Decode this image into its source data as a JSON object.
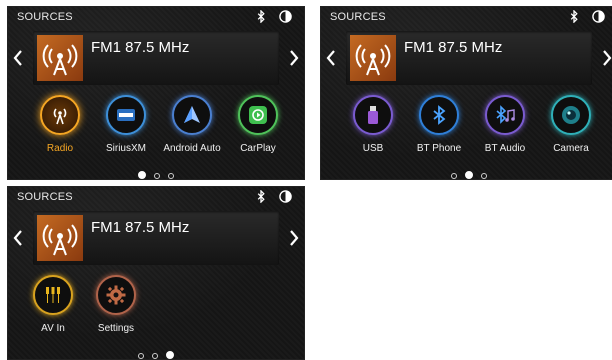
{
  "screens": [
    {
      "title": "SOURCES",
      "station": "FM1 87.5 MHz",
      "sources": [
        {
          "label": "Radio",
          "icon": "radio-tower-icon",
          "color": "#f5a623",
          "active": true
        },
        {
          "label": "SiriusXM",
          "icon": "siriusxm-icon",
          "color": "#3d8fd8",
          "active": false
        },
        {
          "label": "Android Auto",
          "icon": "android-auto-icon",
          "color": "#4a7fd0",
          "active": false
        },
        {
          "label": "CarPlay",
          "icon": "carplay-icon",
          "color": "#4fc25a",
          "active": false
        }
      ],
      "page": 1,
      "pages": 3
    },
    {
      "title": "SOURCES",
      "station": "FM1 87.5 MHz",
      "sources": [
        {
          "label": "USB",
          "icon": "usb-icon",
          "color": "#7a5bd0",
          "active": false
        },
        {
          "label": "BT Phone",
          "icon": "bluetooth-icon",
          "color": "#2f7fd8",
          "active": false
        },
        {
          "label": "BT Audio",
          "icon": "bluetooth-audio-icon",
          "color": "#7a5bd0",
          "active": false
        },
        {
          "label": "Camera",
          "icon": "camera-icon",
          "color": "#2fb0b8",
          "active": false
        }
      ],
      "page": 2,
      "pages": 3
    },
    {
      "title": "SOURCES",
      "station": "FM1 87.5 MHz",
      "sources": [
        {
          "label": "AV In",
          "icon": "av-in-icon",
          "color": "#d8a21f",
          "active": false
        },
        {
          "label": "Settings",
          "icon": "gear-icon",
          "color": "#b0634a",
          "active": false
        }
      ],
      "page": 3,
      "pages": 3
    }
  ]
}
